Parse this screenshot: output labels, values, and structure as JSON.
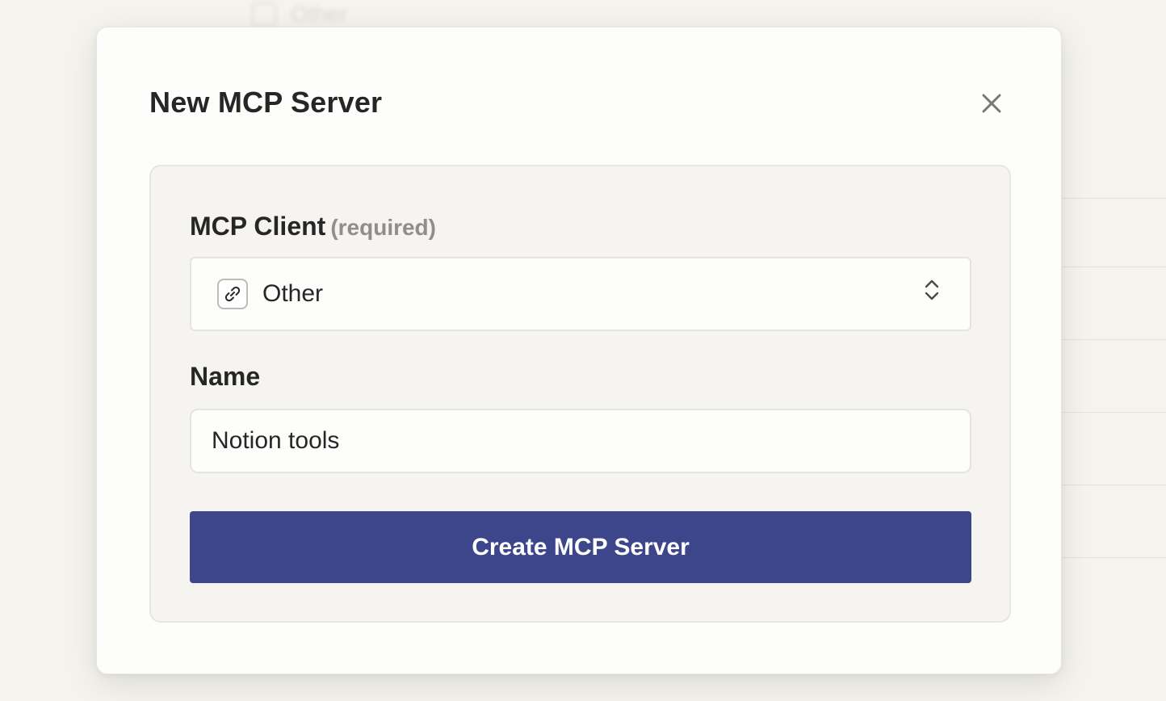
{
  "background": {
    "ghost_item_label": "Other"
  },
  "modal": {
    "title": "New MCP Server",
    "close_icon": "close-icon"
  },
  "form": {
    "client": {
      "label": "MCP Client",
      "required_note": "(required)",
      "selected_value": "Other",
      "icon": "link-icon"
    },
    "name": {
      "label": "Name",
      "value": "Notion tools",
      "placeholder": ""
    },
    "submit_label": "Create MCP Server"
  },
  "colors": {
    "accent": "#3d458b",
    "background": "#f4f3ee",
    "card": "#f5f4f1",
    "text": "#262626",
    "muted": "#8f8e8a"
  }
}
